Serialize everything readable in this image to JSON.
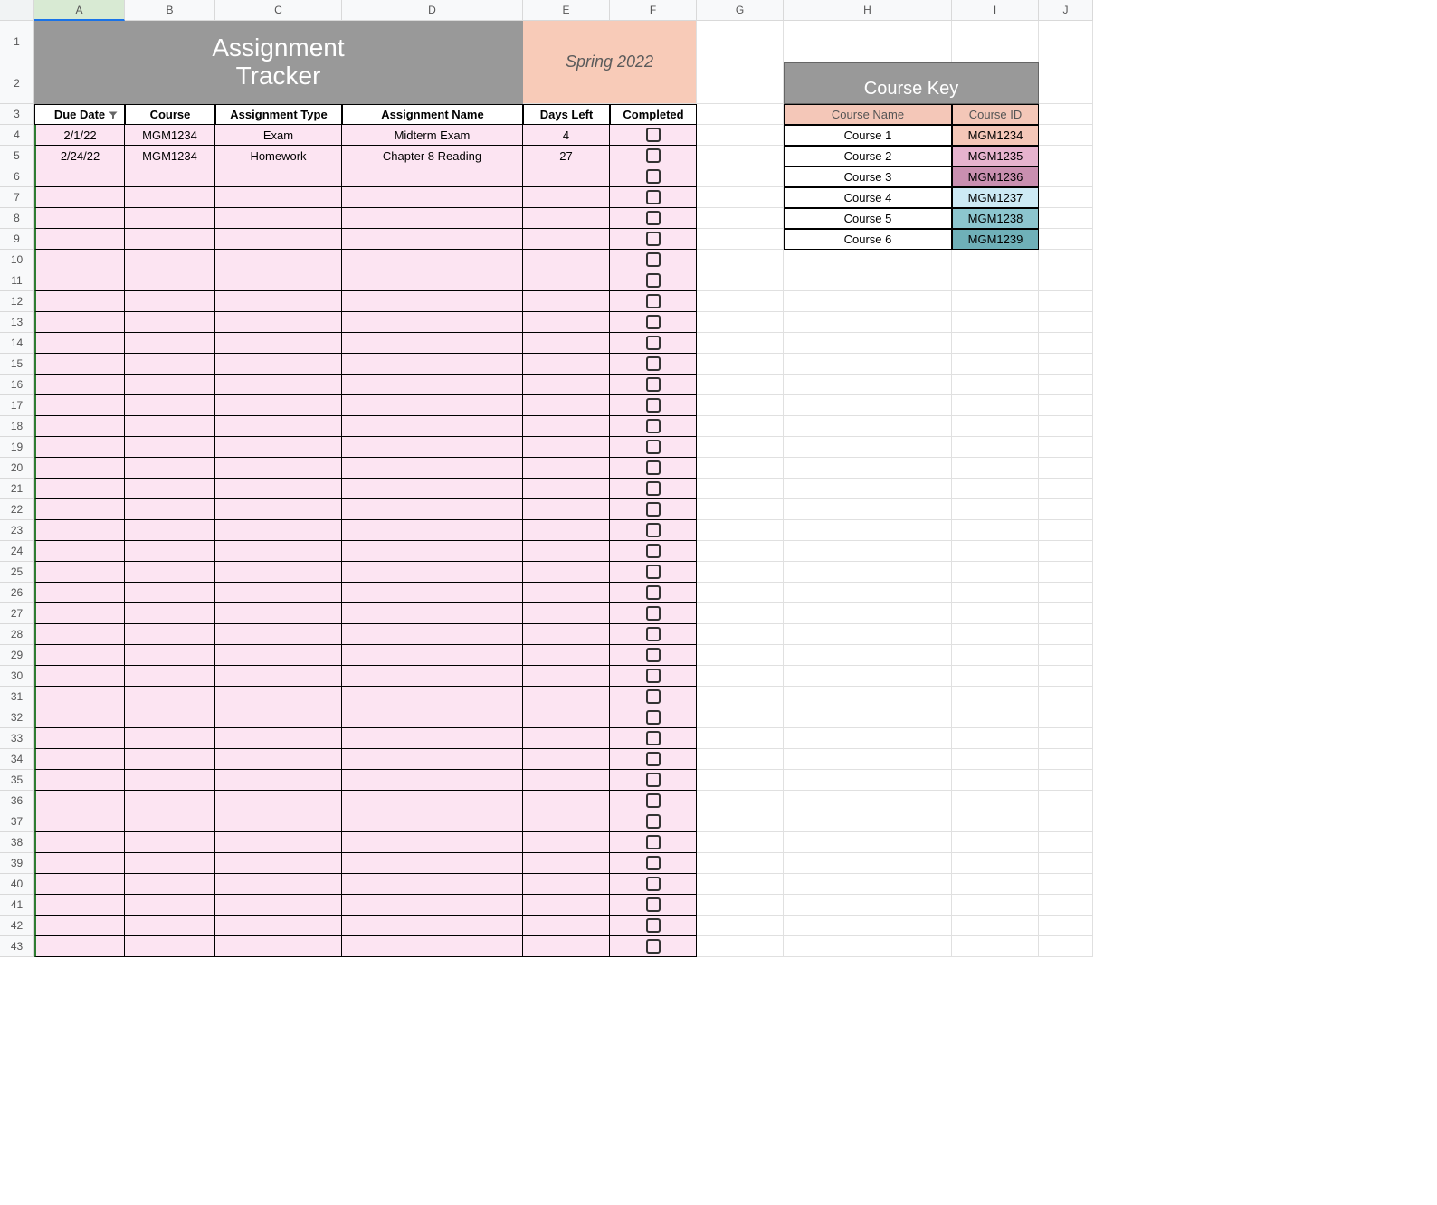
{
  "columns": [
    "A",
    "B",
    "C",
    "D",
    "E",
    "F",
    "G",
    "H",
    "I",
    "J"
  ],
  "title": {
    "line1": "Assignment",
    "line2": "Tracker"
  },
  "term": "Spring 2022",
  "headers": {
    "due": "Due Date",
    "course": "Course",
    "type": "Assignment Type",
    "name": "Assignment Name",
    "days": "Days Left",
    "completed": "Completed"
  },
  "rows": [
    {
      "due": "2/1/22",
      "course": "MGM1234",
      "type": "Exam",
      "name": "Midterm Exam",
      "days": "4",
      "completed": false
    },
    {
      "due": "2/24/22",
      "course": "MGM1234",
      "type": "Homework",
      "name": "Chapter 8 Reading",
      "days": "27",
      "completed": false
    }
  ],
  "empty_row_count": 38,
  "course_key": {
    "title": "Course Key",
    "headers": {
      "name": "Course Name",
      "id": "Course ID"
    },
    "items": [
      {
        "name": "Course 1",
        "id": "MGM1234",
        "color": "#f4c7b8"
      },
      {
        "name": "Course 2",
        "id": "MGM1235",
        "color": "#e6b3ce"
      },
      {
        "name": "Course 3",
        "id": "MGM1236",
        "color": "#c98fb0"
      },
      {
        "name": "Course 4",
        "id": "MGM1237",
        "color": "#cdeaf5"
      },
      {
        "name": "Course 5",
        "id": "MGM1238",
        "color": "#8cc5ce"
      },
      {
        "name": "Course 6",
        "id": "MGM1239",
        "color": "#6fb0b8"
      }
    ]
  },
  "total_rows": 42
}
